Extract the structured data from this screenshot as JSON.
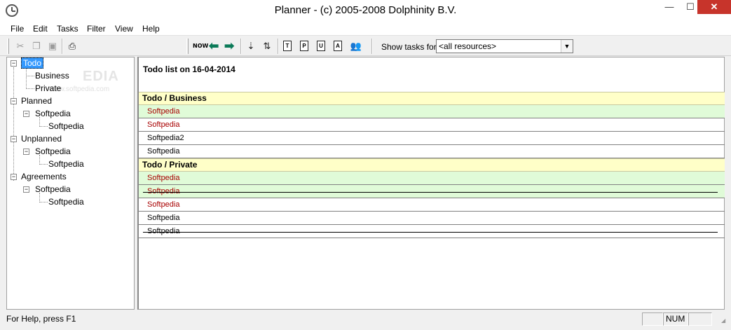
{
  "window": {
    "title": "Planner - (c) 2005-2008 Dolphinity B.V.",
    "minimize": "—",
    "maximize": "☐",
    "close": "✕"
  },
  "menu": [
    "File",
    "Edit",
    "Tasks",
    "Filter",
    "View",
    "Help"
  ],
  "toolbar": {
    "now_label": "NOW",
    "doc_letters": [
      "T",
      "P",
      "U",
      "A"
    ],
    "show_label": "Show tasks for",
    "resource_value": "<all resources>"
  },
  "tree": {
    "watermark": "EDIA",
    "watermark_small": "www.softpedia.com",
    "todo": "Todo",
    "business": "Business",
    "private": "Private",
    "planned": "Planned",
    "planned_child": "Softpedia",
    "planned_grandchild": "Softpedia",
    "unplanned": "Unplanned",
    "unplanned_child": "Softpedia",
    "unplanned_grandchild": "Softpedia",
    "agreements": "Agreements",
    "agreements_child": "Softpedia",
    "agreements_grandchild": "Softpedia"
  },
  "main": {
    "title": "Todo list on 16-04-2014",
    "sections": [
      {
        "header": "Todo / Business",
        "tasks": [
          {
            "text": "Softpedia",
            "highlight": true,
            "red": true,
            "struck": false
          },
          {
            "text": "Softpedia",
            "highlight": false,
            "red": true,
            "struck": false
          },
          {
            "text": "Softpedia2",
            "highlight": false,
            "red": false,
            "struck": false
          },
          {
            "text": "Softpedia",
            "highlight": false,
            "red": false,
            "struck": false
          }
        ]
      },
      {
        "header": "Todo / Private",
        "tasks": [
          {
            "text": "Softpedia",
            "highlight": true,
            "red": true,
            "struck": false
          },
          {
            "text": "Softpedia",
            "highlight": true,
            "red": true,
            "struck": true
          },
          {
            "text": "Softpedia",
            "highlight": false,
            "red": true,
            "struck": false
          },
          {
            "text": "Softpedia",
            "highlight": false,
            "red": false,
            "struck": false
          },
          {
            "text": "Softpedia",
            "highlight": false,
            "red": false,
            "struck": true
          }
        ]
      }
    ]
  },
  "status": {
    "help_text": "For Help, press F1",
    "num": "NUM"
  },
  "colors": {
    "section_header": "#ffffc8",
    "highlight_row": "#e0fbd8",
    "red_text": "#a80000",
    "selection": "#3399ff"
  }
}
